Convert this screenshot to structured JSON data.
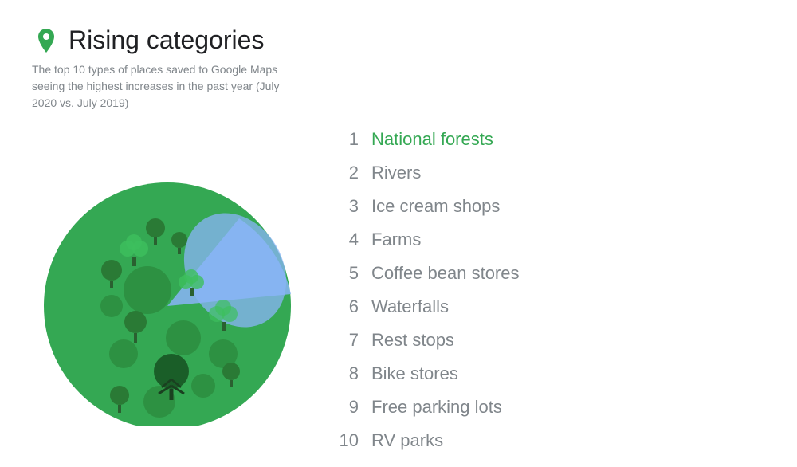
{
  "header": {
    "title": "Rising categories",
    "subtitle": "The top 10 types of places saved to Google Maps seeing the highest increases in the past year (July 2020 vs. July 2019)"
  },
  "chart": {
    "green_label": "National forests",
    "blue_label": "Rivers"
  },
  "list": {
    "items": [
      {
        "rank": "1",
        "label": "National forests",
        "highlight": true
      },
      {
        "rank": "2",
        "label": "Rivers",
        "highlight": false
      },
      {
        "rank": "3",
        "label": "Ice cream shops",
        "highlight": false
      },
      {
        "rank": "4",
        "label": "Farms",
        "highlight": false
      },
      {
        "rank": "5",
        "label": "Coffee bean stores",
        "highlight": false
      },
      {
        "rank": "6",
        "label": "Waterfalls",
        "highlight": false
      },
      {
        "rank": "7",
        "label": "Rest stops",
        "highlight": false
      },
      {
        "rank": "8",
        "label": "Bike stores",
        "highlight": false
      },
      {
        "rank": "9",
        "label": "Free parking lots",
        "highlight": false
      },
      {
        "rank": "10",
        "label": "RV parks",
        "highlight": false
      }
    ]
  }
}
